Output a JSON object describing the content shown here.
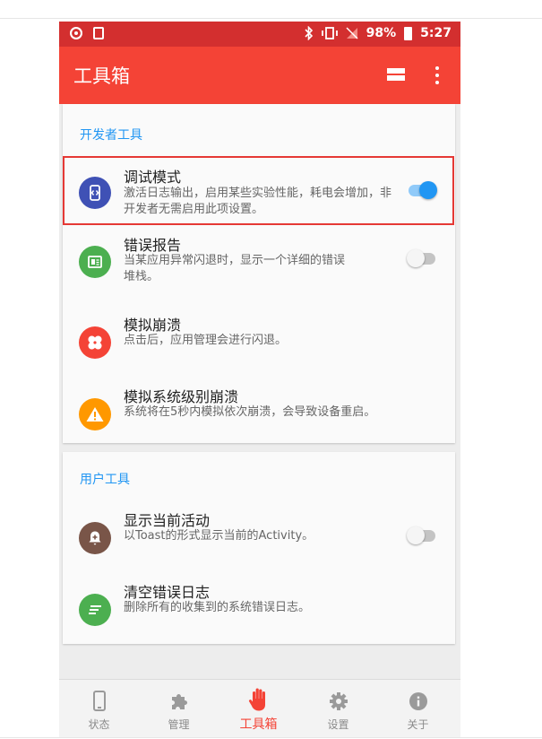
{
  "status_bar": {
    "battery": "98%",
    "time": "5:27"
  },
  "app_bar": {
    "title": "工具箱"
  },
  "sections": {
    "developer": {
      "title": "开发者工具",
      "items": [
        {
          "title": "调试模式",
          "desc": "激活日志输出，启用某些实验性能，耗电会增加，非开发者无需启用此项设置。",
          "toggle": true,
          "icon": "debug-icon",
          "color": "#3f51b5"
        },
        {
          "title": "错误报告",
          "desc": "当某应用异常闪退时，显示一个详细的错误堆栈。",
          "toggle": false,
          "icon": "report-icon",
          "color": "#4caf50"
        },
        {
          "title": "模拟崩溃",
          "desc": "点击后，应用管理会进行闪退。",
          "icon": "bandage-icon",
          "color": "#f44336"
        },
        {
          "title": "模拟系统级别崩溃",
          "desc": "系统将在5秒内模拟依次崩溃，会导致设备重启。",
          "icon": "warning-icon",
          "color": "#ff9800"
        }
      ]
    },
    "user": {
      "title": "用户工具",
      "items": [
        {
          "title": "显示当前活动",
          "desc": "以Toast的形式显示当前的Activity。",
          "toggle": false,
          "icon": "alert-add-icon",
          "color": "#795548"
        },
        {
          "title": "清空错误日志",
          "desc": "删除所有的收集到的系统错误日志。",
          "icon": "clear-list-icon",
          "color": "#4caf50"
        }
      ]
    }
  },
  "bottom_nav": [
    {
      "label": "状态",
      "icon": "phone-icon",
      "active": false
    },
    {
      "label": "管理",
      "icon": "puzzle-icon",
      "active": false
    },
    {
      "label": "工具箱",
      "icon": "hand-icon",
      "active": true
    },
    {
      "label": "设置",
      "icon": "gear-icon",
      "active": false
    },
    {
      "label": "关于",
      "icon": "info-icon",
      "active": false
    }
  ],
  "colors": {
    "primary": "#f44336",
    "primary_dark": "#d32f2f",
    "accent": "#2196f3",
    "highlight_frame": "#e53935"
  }
}
